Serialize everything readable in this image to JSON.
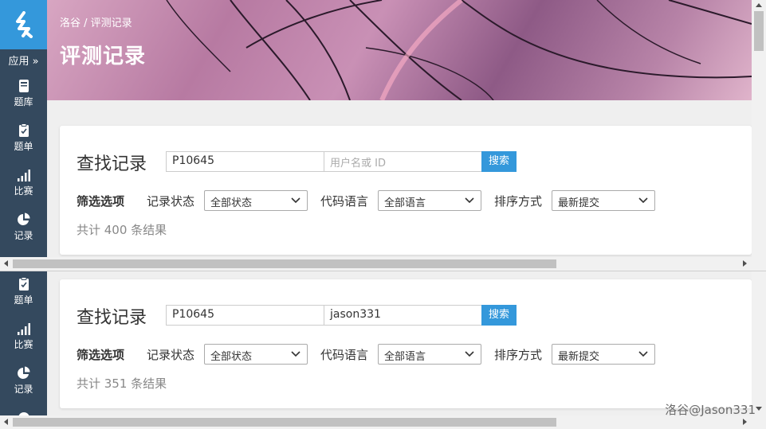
{
  "sidebar": {
    "apps_label": "应用 »",
    "items_top": [
      {
        "label": "题库",
        "icon": "book-icon"
      },
      {
        "label": "题单",
        "icon": "clipboard-icon"
      },
      {
        "label": "比赛",
        "icon": "signal-bars-icon"
      },
      {
        "label": "记录",
        "icon": "pie-chart-icon"
      }
    ],
    "items_bottom": [
      {
        "label": "题单",
        "icon": "clipboard-icon"
      },
      {
        "label": "比赛",
        "icon": "signal-bars-icon"
      },
      {
        "label": "记录",
        "icon": "pie-chart-icon"
      }
    ]
  },
  "header": {
    "breadcrumb": "洛谷 / 评测记录",
    "title": "评测记录"
  },
  "panel1": {
    "card_title": "查找记录",
    "problem_value": "P10645",
    "user_value": "",
    "user_placeholder": "用户名或 ID",
    "search_label": "搜索",
    "filter_title": "筛选选项",
    "status_label": "记录状态",
    "status_value": "全部状态",
    "language_label": "代码语言",
    "language_value": "全部语言",
    "order_label": "排序方式",
    "order_value": "最新提交",
    "result_count": "共计 400 条结果"
  },
  "panel2": {
    "card_title": "查找记录",
    "problem_value": "P10645",
    "user_value": "jason331",
    "search_label": "搜索",
    "filter_title": "筛选选项",
    "status_label": "记录状态",
    "status_value": "全部状态",
    "language_label": "代码语言",
    "language_value": "全部语言",
    "order_label": "排序方式",
    "order_value": "最新提交",
    "result_count": "共计 351 条结果"
  },
  "watermark": "洛谷@Jason331",
  "colors": {
    "sidebar": "#34495e",
    "logo": "#3498db",
    "accent": "#3498db"
  }
}
